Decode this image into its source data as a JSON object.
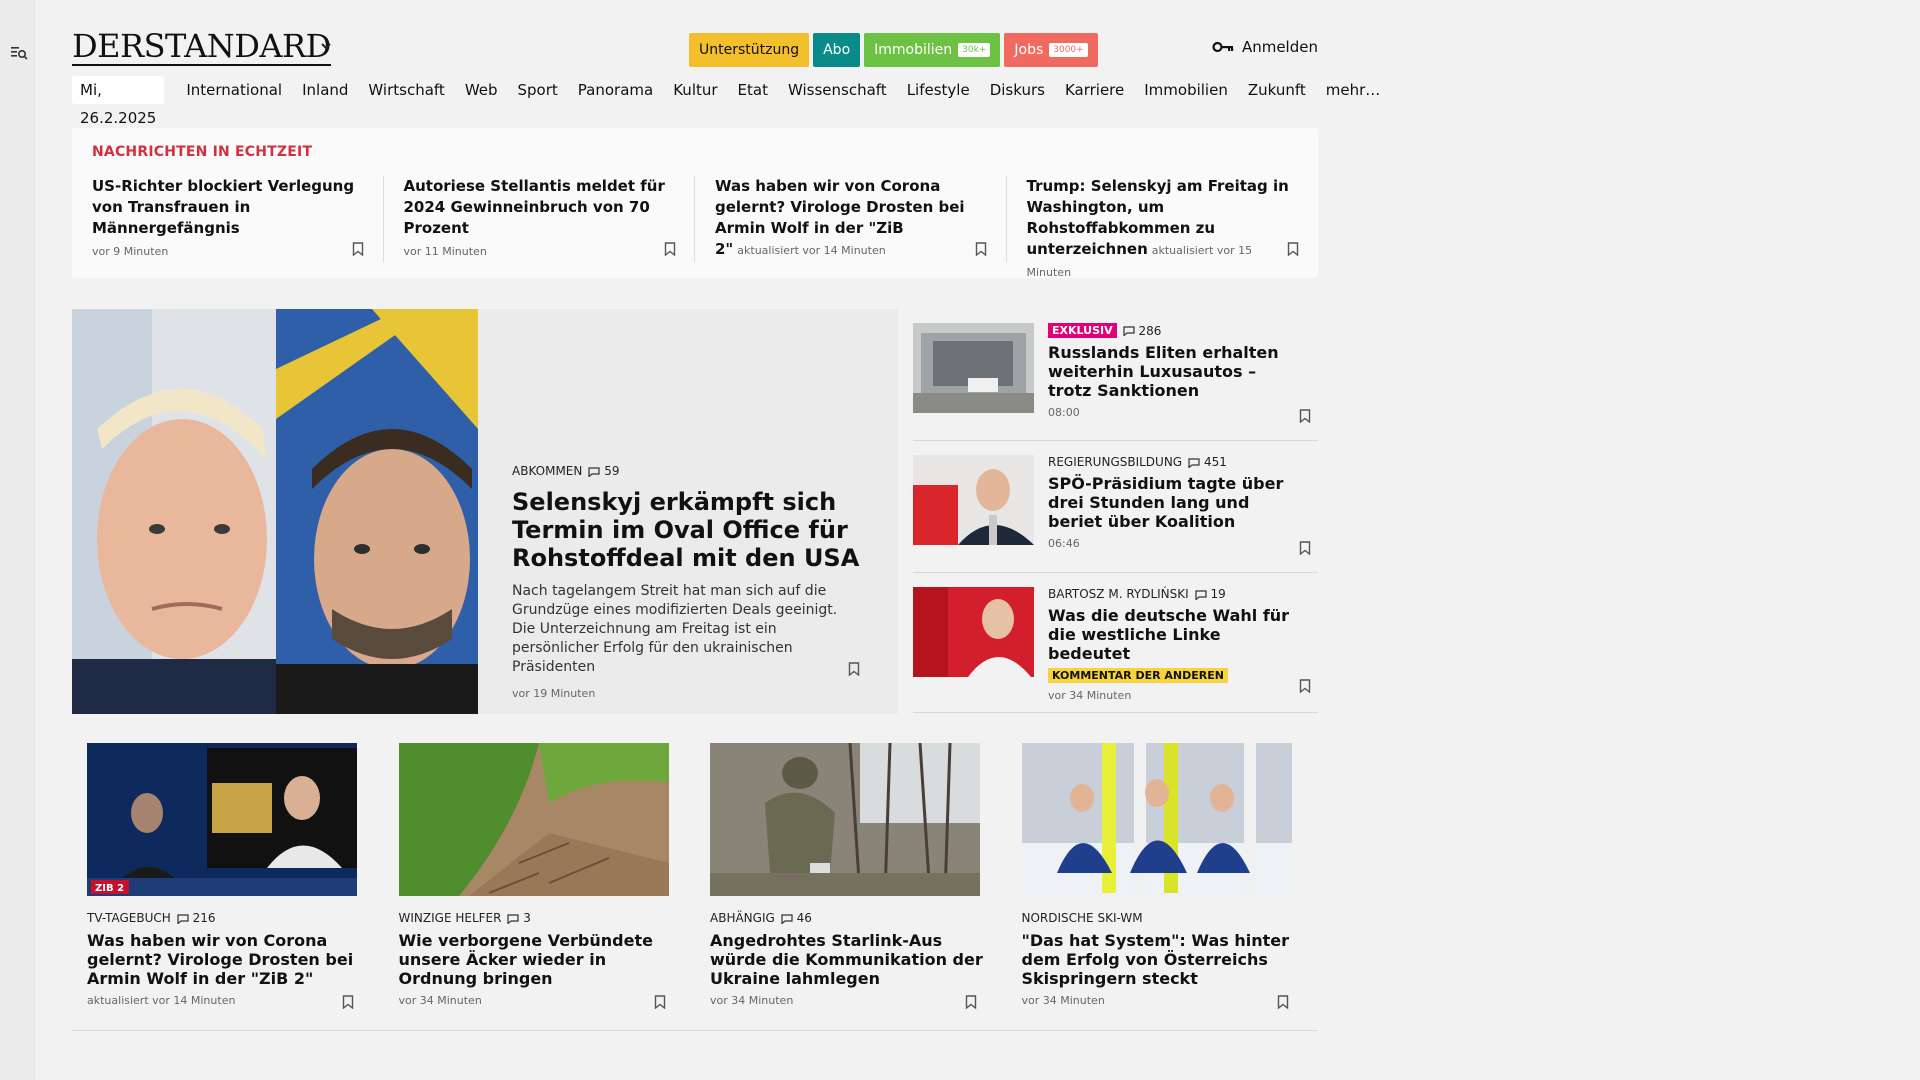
{
  "header": {
    "logo": "DERSTANDARD",
    "promos": {
      "support": "Unterstützung",
      "abo": "Abo",
      "immo": "Immobilien",
      "immo_tag": "30k+",
      "jobs": "Jobs",
      "jobs_tag": "3000+"
    },
    "login": "Anmelden"
  },
  "nav": {
    "date": "Mi, 26.2.2025",
    "items": [
      "International",
      "Inland",
      "Wirtschaft",
      "Web",
      "Sport",
      "Panorama",
      "Kultur",
      "Etat",
      "Wissenschaft",
      "Lifestyle",
      "Diskurs",
      "Karriere",
      "Immobilien",
      "Zukunft",
      "mehr…"
    ]
  },
  "live": {
    "title": "NACHRICHTEN IN ECHTZEIT",
    "items": [
      {
        "headline": "US-Richter blockiert Verlegung von Transfrauen in Männergefängnis",
        "meta": "vor 9 Minuten"
      },
      {
        "headline": "Autoriese Stellantis meldet für 2024 Gewinneinbruch von 70 Prozent",
        "meta": "vor 11 Minuten"
      },
      {
        "headline": "Was haben wir von Corona gelernt? Virologe Drosten bei Armin Wolf in der \"ZiB 2\"",
        "meta": "aktualisiert vor 14 Minuten"
      },
      {
        "headline": "Trump: Selenskyj am Freitag in Washington, um Rohstoffabkommen zu unterzeichnen",
        "meta": "aktualisiert vor 15 Minuten"
      }
    ]
  },
  "hero": {
    "kicker": "ABKOMMEN",
    "comments": "59",
    "title": "Selenskyj erkämpft sich Termin im Oval Office für Rohstoffdeal mit den USA",
    "summary": "Nach tagelangem Streit hat man sich auf die Grundzüge eines modifizierten Deals geeinigt. Die Unterzeichnung am Freitag ist ein persönlicher Erfolg für den ukrainischen Präsidenten",
    "time": "vor 19 Minuten"
  },
  "side": [
    {
      "badge": "EXKLUSIV",
      "comments": "286",
      "title": "Russlands Eliten erhalten weiterhin Luxusautos – trotz Sanktionen",
      "time": "08:00"
    },
    {
      "kicker": "REGIERUNGSBILDUNG",
      "comments": "451",
      "title": "SPÖ-Präsidium tagte über drei Stunden lang und beriet über Koalition",
      "time": "06:46"
    },
    {
      "kicker": "BARTOSZ M. RYDLIŃSKI",
      "comments": "19",
      "title": "Was die deutsche Wahl für die westliche Linke bedeutet",
      "label": "KOMMENTAR DER ANDEREN",
      "time": "vor 34 Minuten"
    }
  ],
  "teasers": [
    {
      "kicker": "TV-TAGEBUCH",
      "comments": "216",
      "title": "Was haben wir von Corona gelernt? Virologe Drosten bei Armin Wolf in der \"ZiB 2\"",
      "time": "aktualisiert vor 14 Minuten",
      "img_label": "ZIB 2"
    },
    {
      "kicker": "WINZIGE HELFER",
      "comments": "3",
      "title": "Wie verborgene Verbündete unsere Äcker wieder in Ordnung bringen",
      "time": "vor 34 Minuten"
    },
    {
      "kicker": "ABHÄNGIG",
      "comments": "46",
      "title": "Angedrohtes Starlink-Aus würde die Kommunikation der Ukraine lahmlegen",
      "time": "vor 34 Minuten"
    },
    {
      "kicker": "NORDISCHE SKI-WM",
      "comments": "",
      "title": "\"Das hat System\": Was hinter dem Erfolg von Österreichs Skispringern steckt",
      "time": "vor 34 Minuten"
    }
  ],
  "colors": {
    "live_title": "#d32f3f",
    "exklusiv": "#e2007a",
    "comment_badge": "#f7d43a",
    "support": "#f3bf2a",
    "abo": "#0b8a8a",
    "immo": "#6cc242",
    "jobs": "#f06a5f"
  },
  "icons": [
    "search-menu-icon",
    "chevron-down-icon",
    "key-icon",
    "bookmark-icon",
    "comment-icon"
  ]
}
